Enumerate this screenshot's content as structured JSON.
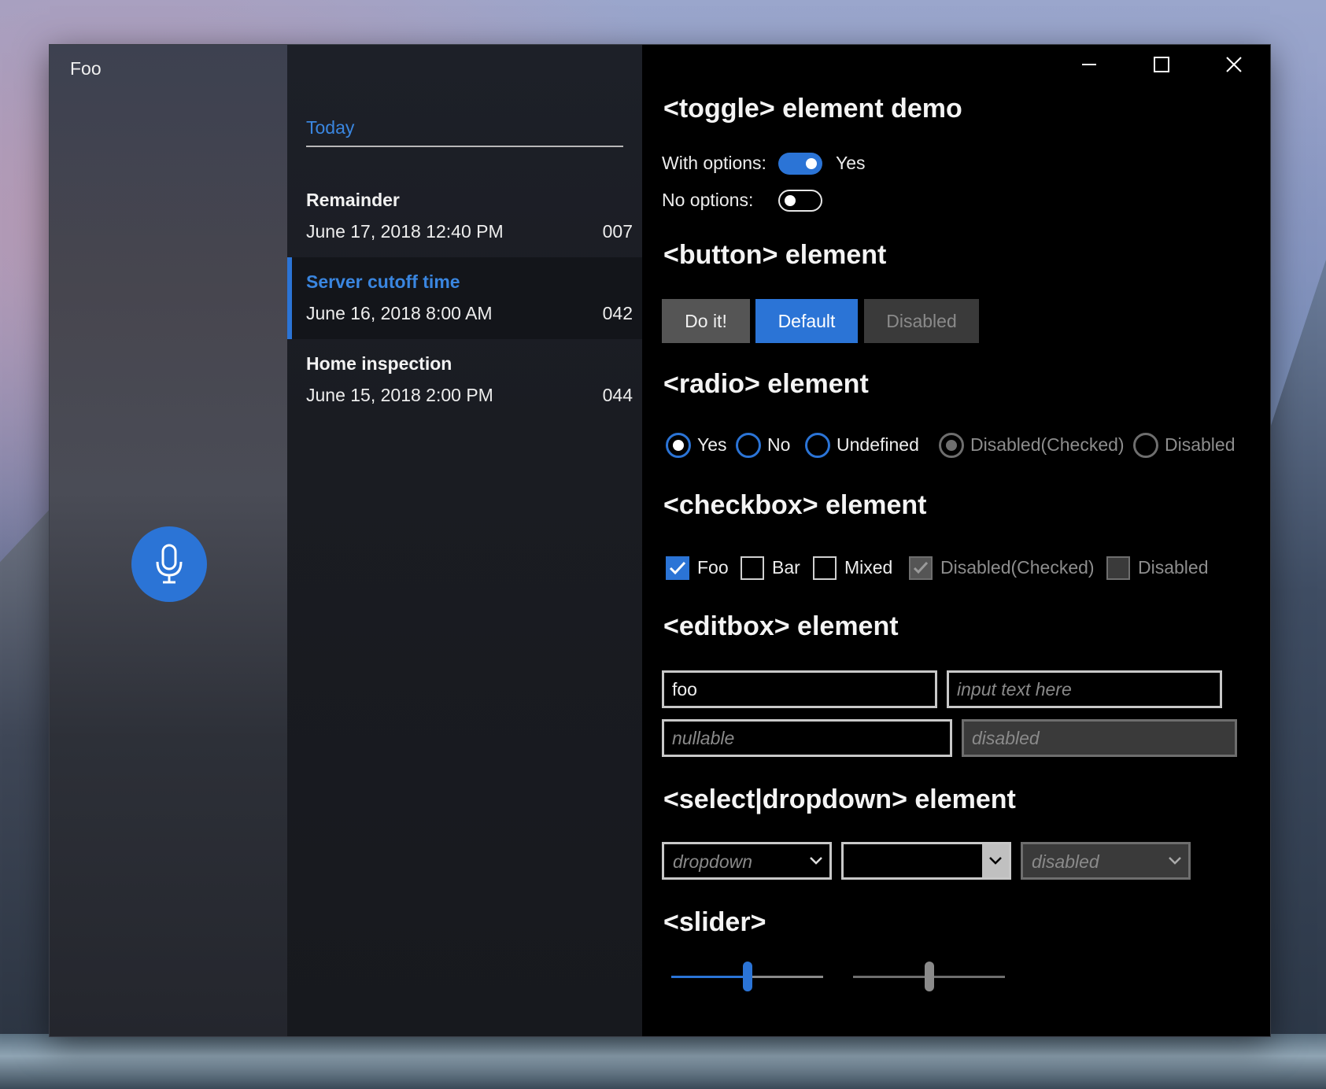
{
  "window": {
    "title": "Foo",
    "controls": {
      "minimize": "minimize",
      "maximize": "maximize",
      "close": "close"
    }
  },
  "list": {
    "header": "Today",
    "items": [
      {
        "title": "Remainder",
        "date": "June 17, 2018  12:40 PM",
        "number": "007",
        "selected": false
      },
      {
        "title": "Server cutoff time",
        "date": "June 16, 2018  8:00 AM",
        "number": "042",
        "selected": true
      },
      {
        "title": "Home inspection",
        "date": "June 15, 2018  2:00 PM",
        "number": "044",
        "selected": false
      }
    ]
  },
  "demo": {
    "toggle": {
      "title": "<toggle> element demo",
      "with_options_label": "With options:",
      "with_options_state": "Yes",
      "with_options_on": true,
      "no_options_label": "No options:",
      "no_options_on": false
    },
    "button": {
      "title": "<button> element",
      "buttons": [
        "Do it!",
        "Default",
        "Disabled"
      ]
    },
    "radio": {
      "title": "<radio> element",
      "options": [
        "Yes",
        "No",
        "Undefined",
        "Disabled(Checked)",
        "Disabled"
      ],
      "selected": "Yes"
    },
    "checkbox": {
      "title": "<checkbox> element",
      "options": [
        "Foo",
        "Bar",
        "Mixed",
        "Disabled(Checked)",
        "Disabled"
      ],
      "checked": [
        "Foo",
        "Disabled(Checked)"
      ]
    },
    "editbox": {
      "title": "<editbox> element",
      "fields": [
        {
          "value": "foo",
          "placeholder": ""
        },
        {
          "value": "",
          "placeholder": "input text here"
        },
        {
          "value": "",
          "placeholder": "nullable"
        },
        {
          "value": "",
          "placeholder": "disabled"
        }
      ]
    },
    "select": {
      "title": "<select|dropdown> element",
      "dropdowns": [
        "dropdown",
        "",
        "disabled"
      ]
    },
    "slider": {
      "title": "<slider>",
      "values": [
        0.5,
        0.5
      ]
    }
  },
  "colors": {
    "accent": "#2b74d6",
    "selected_text": "#3a86e0",
    "disabled": "#6e6e6e"
  }
}
